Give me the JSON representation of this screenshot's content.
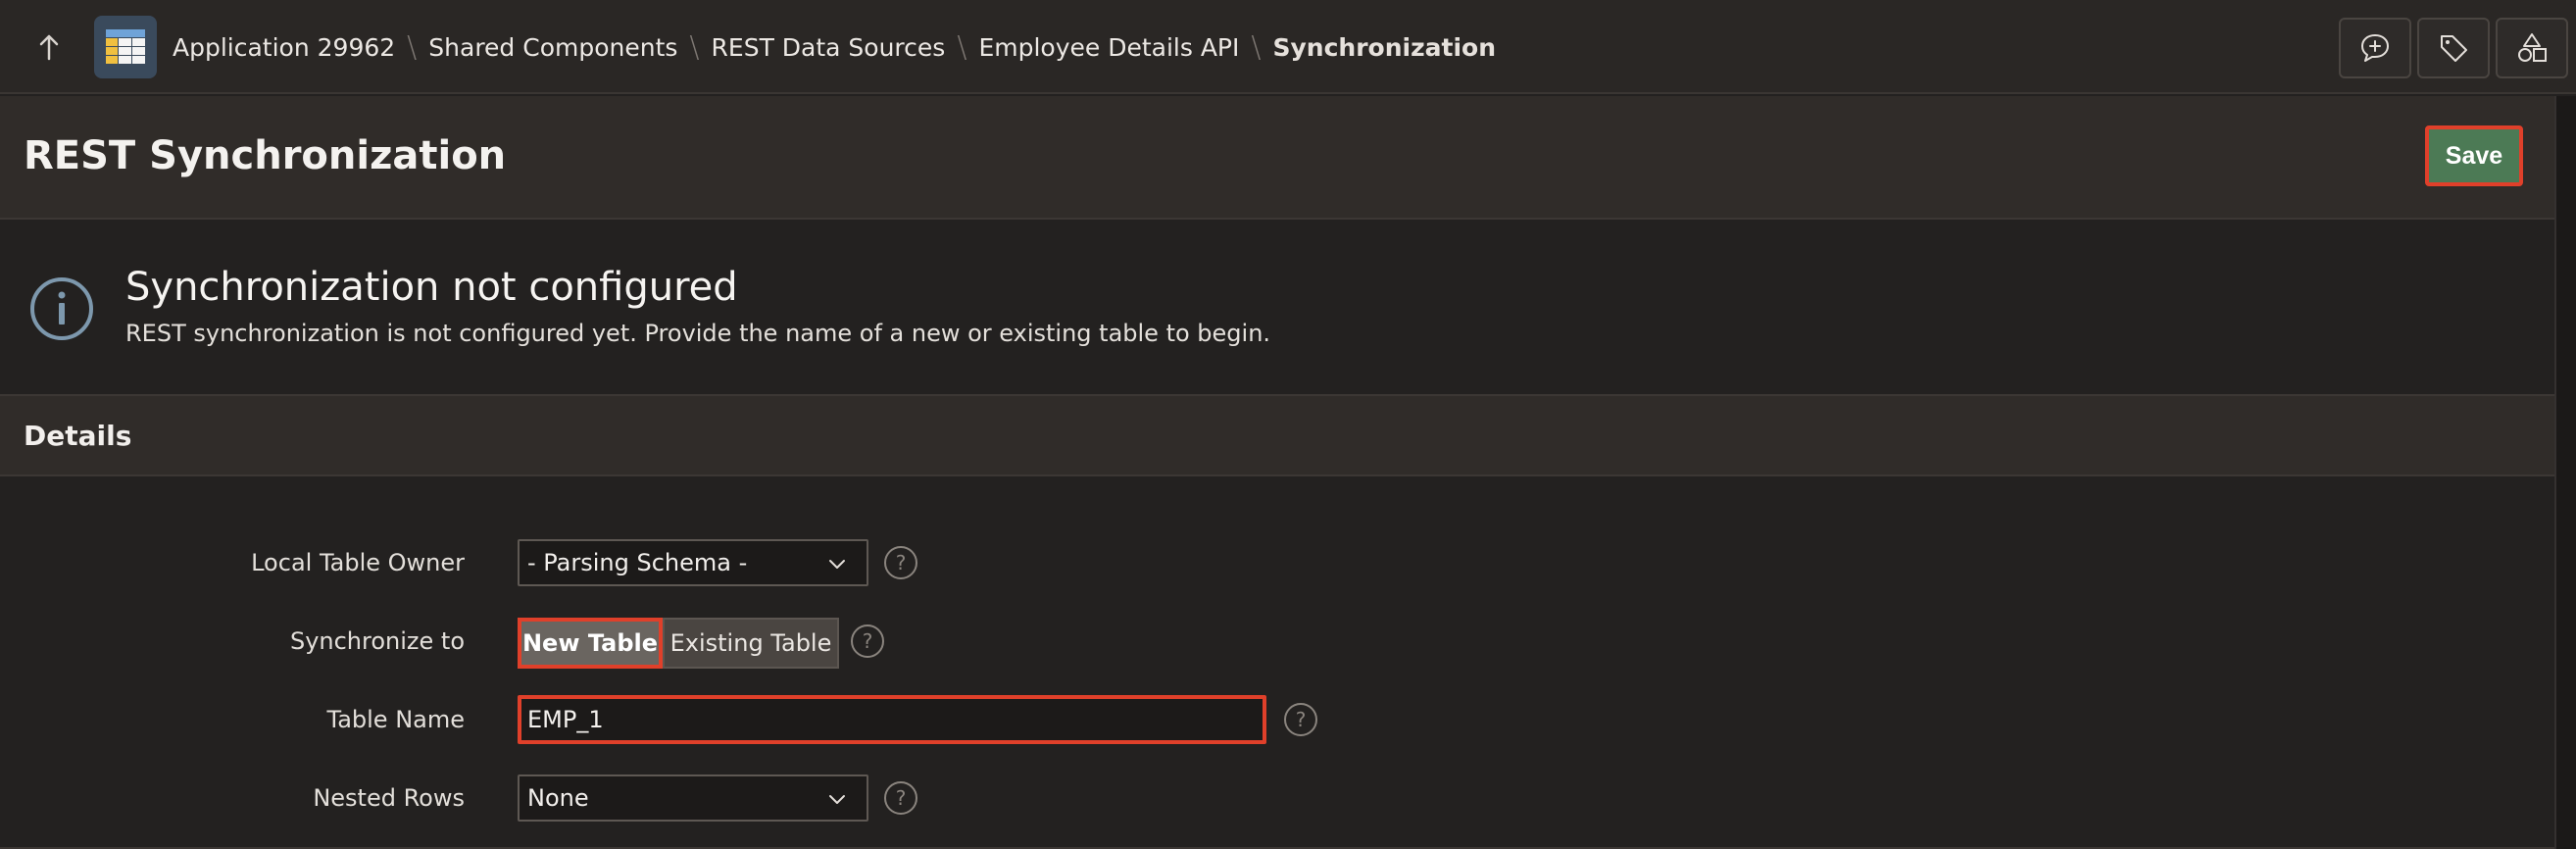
{
  "topbar": {
    "breadcrumbs": [
      {
        "label": "Application 29962"
      },
      {
        "label": "Shared Components"
      },
      {
        "label": "REST Data Sources"
      },
      {
        "label": "Employee Details API"
      },
      {
        "label": "Synchronization"
      }
    ],
    "icons": [
      "arrow-up-icon",
      "app-grid-icon",
      "add-comment-icon",
      "tag-icon",
      "shapes-icon"
    ]
  },
  "header": {
    "title": "REST Synchronization",
    "save_label": "Save"
  },
  "alert": {
    "title": "Synchronization not configured",
    "message": "REST synchronization is not configured yet. Provide the name of a new or existing table to begin."
  },
  "details": {
    "title": "Details",
    "fields": {
      "local_table_owner": {
        "label": "Local Table Owner",
        "value": "- Parsing Schema -"
      },
      "synchronize_to": {
        "label": "Synchronize to",
        "options": [
          "New Table",
          "Existing Table"
        ],
        "selected": "New Table"
      },
      "table_name": {
        "label": "Table Name",
        "value": "EMP_1"
      },
      "nested_rows": {
        "label": "Nested Rows",
        "value": "None"
      }
    },
    "help_glyph": "?"
  },
  "colors": {
    "save_button": "#4c7a55",
    "highlight_border": "#e0402a",
    "background": "#232120"
  }
}
